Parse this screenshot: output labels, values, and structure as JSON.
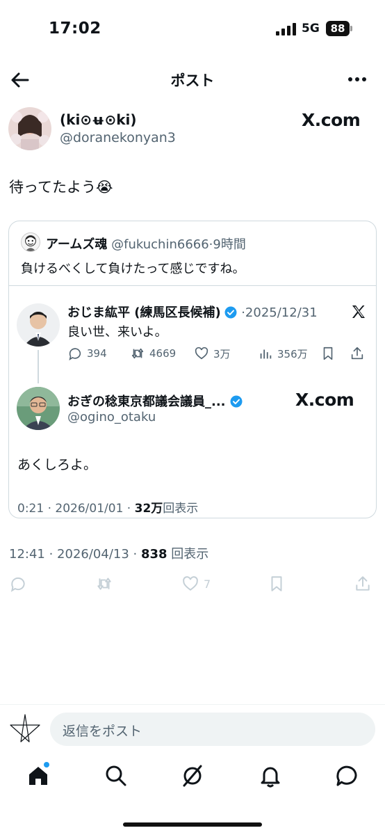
{
  "status_bar": {
    "time": "17:02",
    "network": "5G",
    "battery": "88"
  },
  "nav": {
    "title": "ポスト"
  },
  "post": {
    "name": "(ki⊙ʉ⊙ki)",
    "handle": "@doranekonyan3",
    "source_badge": "X.com",
    "text": "待ってたよう😭",
    "time": "12:41",
    "date": "2026/04/13",
    "views": "838",
    "views_label": "回表示",
    "like_count": "7"
  },
  "quote": {
    "name": "アームズ魂",
    "handle": "@fukuchin6666",
    "age": "9時間",
    "text": "負けるべくして負けたって感じですね。",
    "embedded": {
      "name": "おじま紘平 (練馬区長候補)",
      "date": "2025/12/31",
      "text": "良い世、来いよ。",
      "reply_count": "394",
      "repost_count": "4669",
      "like_count": "3万",
      "view_count": "356万"
    },
    "reply": {
      "name": "おぎの稔東京都議会議員_...",
      "handle": "@ogino_otaku",
      "source_badge": "X.com",
      "text": "あくしろよ。",
      "time": "0:21",
      "date": "2026/01/01",
      "views": "32万",
      "views_label": "回表示"
    }
  },
  "composer": {
    "placeholder": "返信をポスト"
  },
  "colors": {
    "accent": "#1d9bf0",
    "text": "#0f1419",
    "secondary": "#536471",
    "border": "#cfd9de"
  },
  "tabs": [
    "home-icon",
    "search-icon",
    "grok-icon",
    "notifications-icon",
    "messages-icon"
  ]
}
